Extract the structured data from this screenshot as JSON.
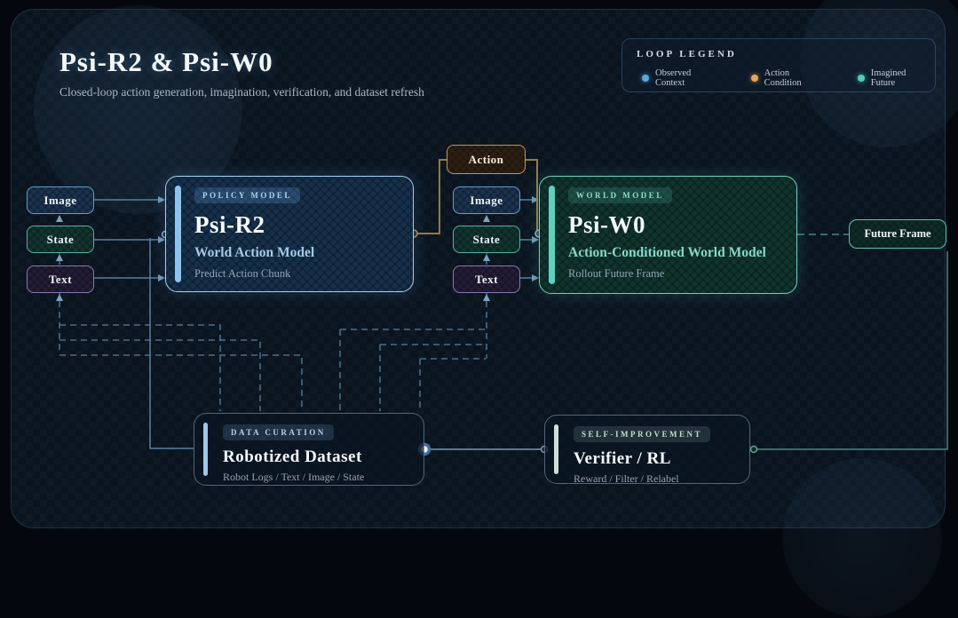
{
  "page": {
    "title": "Psi-R2 & Psi-W0",
    "subtitle": "Closed-loop action generation, imagination, verification, and dataset refresh"
  },
  "legend": {
    "title": "LOOP LEGEND",
    "items": [
      {
        "label": "Observed Context",
        "color": "#5aa7e0"
      },
      {
        "label": "Action Condition",
        "color": "#e8a55a"
      },
      {
        "label": "Imagined Future",
        "color": "#4ecdb8"
      }
    ]
  },
  "inputs_left": {
    "image": "Image",
    "state": "State",
    "text": "Text"
  },
  "inputs_mid": {
    "image": "Image",
    "state": "State",
    "text": "Text"
  },
  "action_node": {
    "label": "Action"
  },
  "policy_model": {
    "badge": "POLICY MODEL",
    "title": "Psi-R2",
    "subtitle": "World Action Model",
    "description": "Predict Action Chunk"
  },
  "world_model": {
    "badge": "WORLD MODEL",
    "title": "Psi-W0",
    "subtitle": "Action-Conditioned World Model",
    "description": "Rollout Future Frame"
  },
  "future_frame": {
    "label": "Future Frame"
  },
  "data_curation": {
    "badge": "DATA CURATION",
    "title": "Robotized Dataset",
    "description": "Robot Logs / Text / Image / State"
  },
  "self_improvement": {
    "badge": "SELF-IMPROVEMENT",
    "title": "Verifier / RL",
    "description": "Reward / Filter / Relabel"
  },
  "colors": {
    "background": "#0a141f",
    "observed_context": "#5aa7e0",
    "action_condition": "#e8a55a",
    "imagined_future": "#4ecdb8",
    "policy_accent": "#8ec2ec",
    "world_accent": "#5fd0bd",
    "action_border": "#c69454",
    "wire_context": "#55809e",
    "wire_action": "#9a7947",
    "wire_imagined": "#49897d"
  }
}
